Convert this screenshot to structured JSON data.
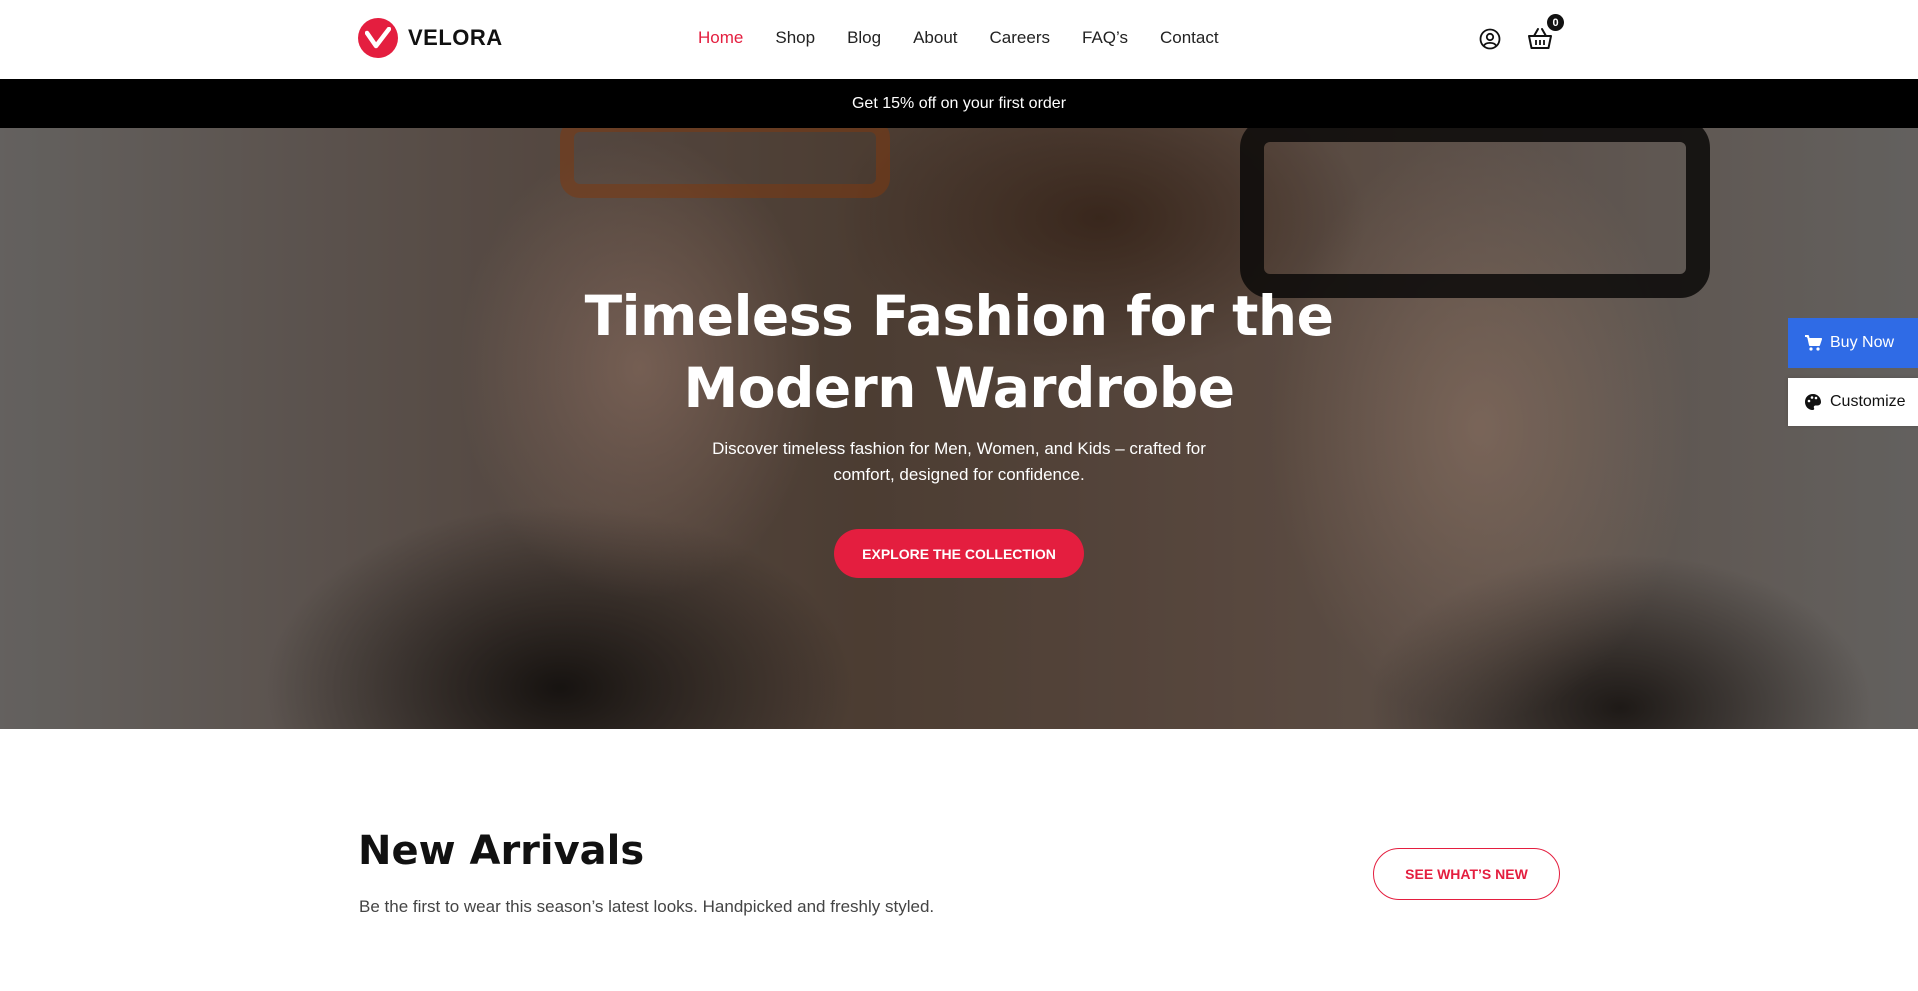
{
  "brand": {
    "name": "VELORA",
    "accent_color": "#e41e3f"
  },
  "nav": {
    "items": [
      {
        "label": "Home",
        "active": true
      },
      {
        "label": "Shop",
        "active": false
      },
      {
        "label": "Blog",
        "active": false
      },
      {
        "label": "About",
        "active": false
      },
      {
        "label": "Careers",
        "active": false
      },
      {
        "label": "FAQ’s",
        "active": false
      },
      {
        "label": "Contact",
        "active": false
      }
    ]
  },
  "header": {
    "account_icon": "user-circle-icon",
    "cart_icon": "basket-icon",
    "cart_count": "0"
  },
  "promo": {
    "text": "Get 15% off on your first order"
  },
  "hero": {
    "title": "Timeless Fashion for the Modern Wardrobe",
    "subtitle": "Discover timeless fashion for Men, Women, and Kids – crafted for comfort, designed for confidence.",
    "cta_label": "EXPLORE THE COLLECTION"
  },
  "side": {
    "buy_label": "Buy Now",
    "buy_color": "#2f6be6",
    "customize_label": "Customize"
  },
  "arrivals": {
    "title": "New Arrivals",
    "subtitle": "Be the first to wear this season’s latest looks. Handpicked and freshly styled.",
    "cta_label": "SEE WHAT’S NEW"
  }
}
